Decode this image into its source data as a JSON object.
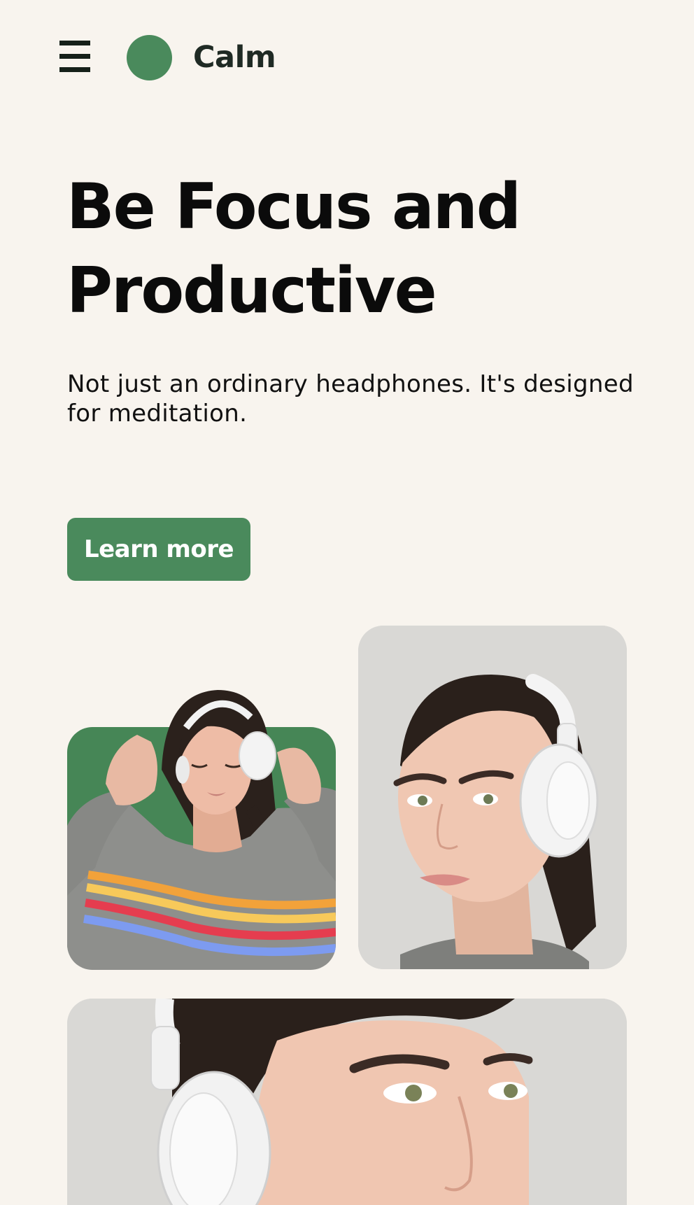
{
  "navbar": {
    "brand": "Calm",
    "menu_icon": "hamburger-menu-icon",
    "logo_icon": "green-circle-logo-icon"
  },
  "hero": {
    "title_line1": "Be Focus and",
    "title_line2": "Productive",
    "subtitle": "Not just an ordinary headphones. It's designed for meditation.",
    "cta_label": "Learn more"
  },
  "gallery": {
    "images": [
      {
        "name": "woman-with-headphones-eyes-closed-photo"
      },
      {
        "name": "woman-with-headphones-smiling-photo"
      },
      {
        "name": "woman-with-headphones-closeup-photo"
      }
    ]
  },
  "colors": {
    "background": "#f8f4ee",
    "accent": "#4a8a5c",
    "text": "#0b0b0b"
  }
}
